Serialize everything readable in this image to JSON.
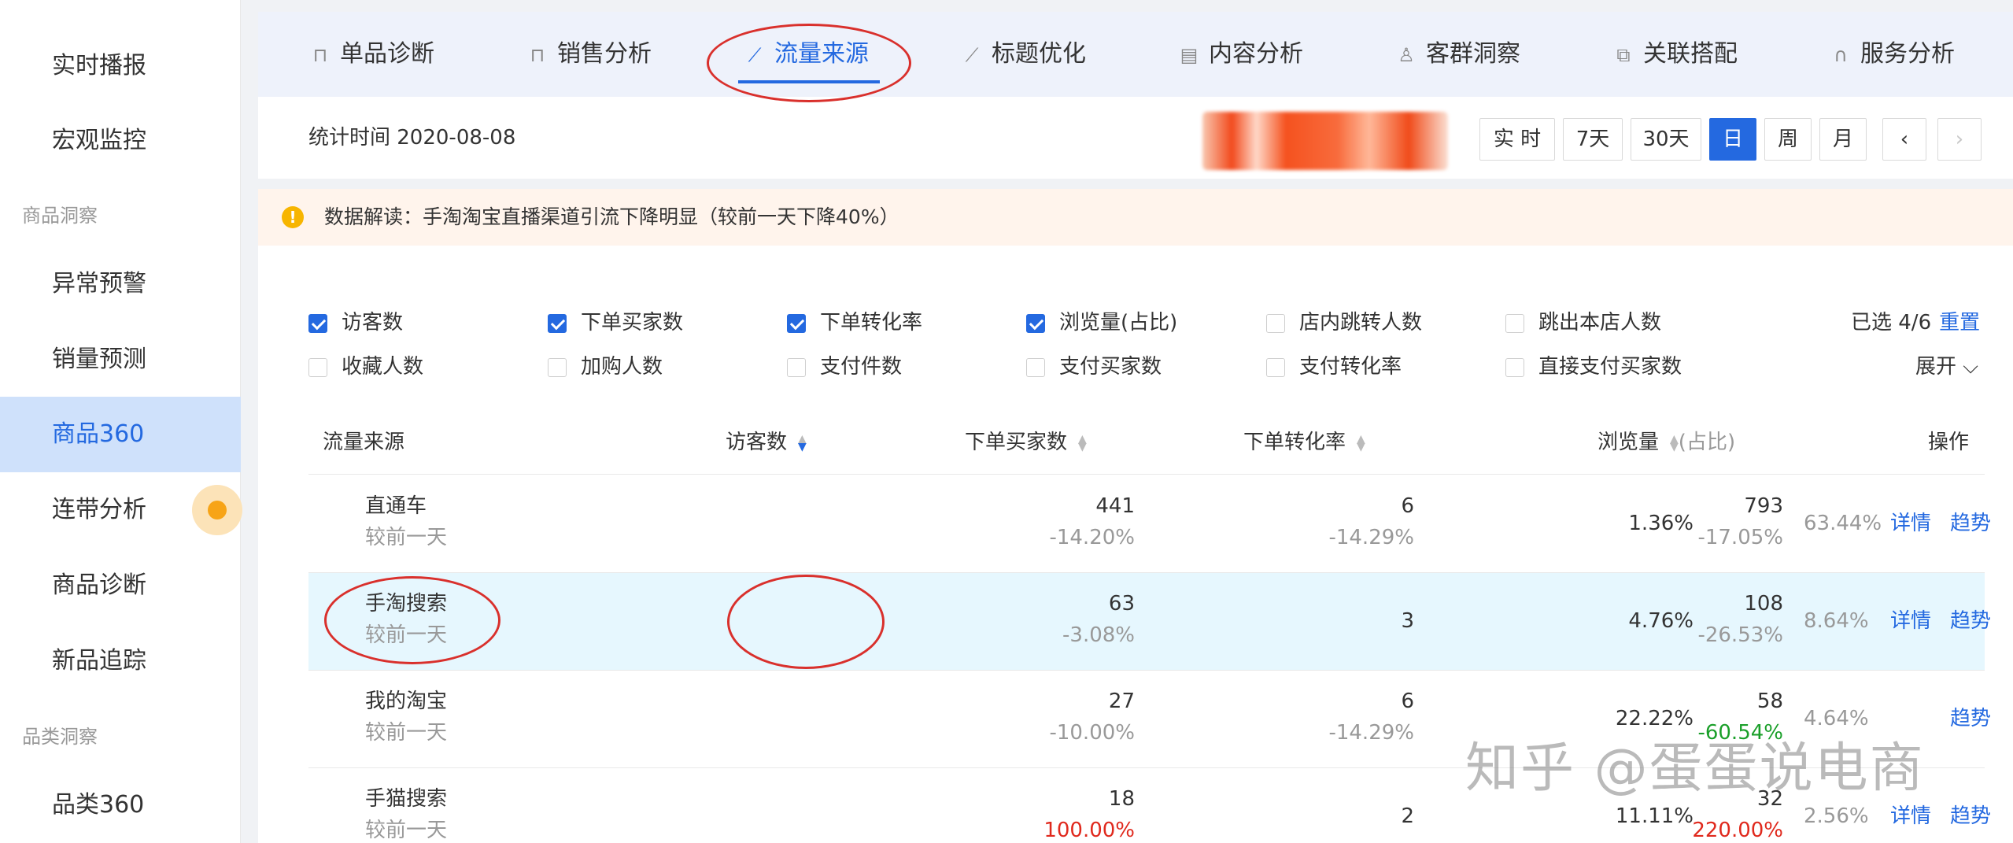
{
  "sidebar": {
    "items_top": [
      "实时播报",
      "宏观监控"
    ],
    "group1": "商品洞察",
    "items_mid": [
      "异常预警",
      "销量预测",
      "商品360",
      "连带分析",
      "商品诊断",
      "新品追踪"
    ],
    "group2": "品类洞察",
    "items_bottom": [
      "品类360"
    ],
    "active_item": "商品360"
  },
  "tabs": [
    {
      "label": "单品诊断",
      "icon": "bag-icon"
    },
    {
      "label": "销售分析",
      "icon": "bag-icon"
    },
    {
      "label": "流量来源",
      "icon": "line-chart-icon",
      "active": true
    },
    {
      "label": "标题优化",
      "icon": "line-chart-icon"
    },
    {
      "label": "内容分析",
      "icon": "document-icon"
    },
    {
      "label": "客群洞察",
      "icon": "users-icon"
    },
    {
      "label": "关联搭配",
      "icon": "link-icon"
    },
    {
      "label": "服务分析",
      "icon": "headset-icon"
    }
  ],
  "timebar": {
    "stat_time": "统计时间 2020-08-08",
    "buttons": [
      "实 时",
      "7天",
      "30天",
      "日",
      "周",
      "月"
    ],
    "active_button": "日",
    "prev_icon": "chevron-left-icon",
    "next_icon": "chevron-right-icon"
  },
  "notice": {
    "icon": "exclamation",
    "text": "数据解读：手淘淘宝直播渠道引流下降明显（较前一天下降40%）"
  },
  "metrics": [
    {
      "label": "访客数",
      "checked": true
    },
    {
      "label": "下单买家数",
      "checked": true
    },
    {
      "label": "下单转化率",
      "checked": true
    },
    {
      "label": "浏览量(占比)",
      "checked": true
    },
    {
      "label": "店内跳转人数",
      "checked": false
    },
    {
      "label": "跳出本店人数",
      "checked": false
    },
    {
      "label": "收藏人数",
      "checked": false
    },
    {
      "label": "加购人数",
      "checked": false
    },
    {
      "label": "支付件数",
      "checked": false
    },
    {
      "label": "支付买家数",
      "checked": false
    },
    {
      "label": "支付转化率",
      "checked": false
    },
    {
      "label": "直接支付买家数",
      "checked": false
    }
  ],
  "selection": {
    "count": "已选 4/6",
    "reset": "重置",
    "expand": "展开"
  },
  "table": {
    "headers": {
      "source": "流量来源",
      "visitors": "访客数",
      "buyers": "下单买家数",
      "conversion": "下单转化率",
      "pageviews": "浏览量",
      "ratio": "(占比)",
      "actions": "操作"
    },
    "rows": [
      {
        "name": "直通车",
        "compare": "较前一天",
        "visitors": "441",
        "visitors_delta": "-14.20%",
        "buyers": "6",
        "buyers_delta": "-14.29%",
        "conversion": "1.36%",
        "pageviews": "793",
        "pageviews_delta": "-17.05%",
        "ratio": "63.44%",
        "detail": "详情",
        "trend": "趋势"
      },
      {
        "name": "手淘搜索",
        "compare": "较前一天",
        "visitors": "63",
        "visitors_delta": "-3.08%",
        "buyers": "3",
        "buyers_delta": "",
        "conversion": "4.76%",
        "pageviews": "108",
        "pageviews_delta": "-26.53%",
        "ratio": "8.64%",
        "detail": "详情",
        "trend": "趋势"
      },
      {
        "name": "我的淘宝",
        "compare": "较前一天",
        "visitors": "27",
        "visitors_delta": "-10.00%",
        "buyers": "6",
        "buyers_delta": "-14.29%",
        "conversion": "22.22%",
        "pageviews": "58",
        "pageviews_delta": "-60.54%",
        "ratio": "4.64%",
        "detail": "",
        "trend": "趋势"
      },
      {
        "name": "手猫搜索",
        "compare": "较前一天",
        "visitors": "18",
        "visitors_delta": "100.00%",
        "buyers": "2",
        "buyers_delta": "",
        "conversion": "11.11%",
        "pageviews": "32",
        "pageviews_delta": "220.00%",
        "ratio": "2.56%",
        "detail": "详情",
        "trend": "趋势"
      }
    ]
  },
  "watermark": "知乎 @蛋蛋说电商",
  "colors": {
    "accent": "#2469e0",
    "annotation": "#d9302c",
    "highlight_row": "#e6f7fe",
    "notice_bg": "#fff4ec"
  }
}
